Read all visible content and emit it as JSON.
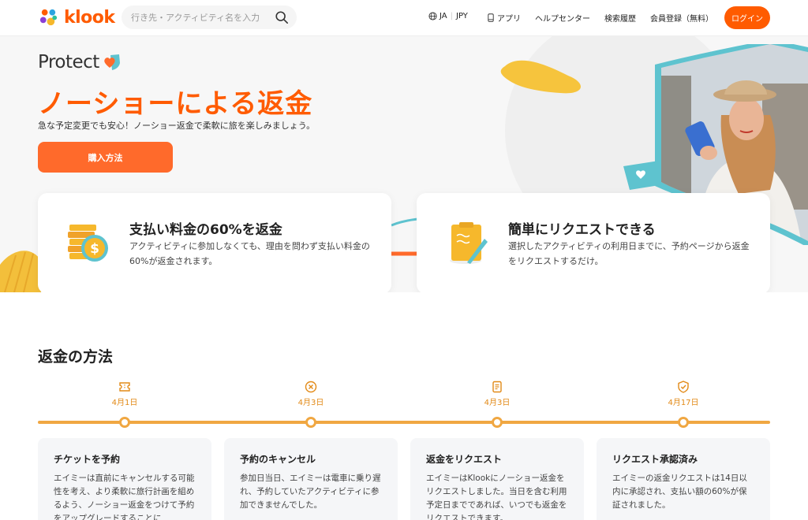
{
  "header": {
    "logo_text": "klook",
    "search_placeholder": "行き先・アクティビティ名を入力",
    "nav": {
      "lang": "JA",
      "currency": "JPY",
      "app": "アプリ",
      "help": "ヘルプセンター",
      "history": "検索履歴",
      "signup": "会員登録（無料）",
      "login": "ログイン"
    }
  },
  "hero": {
    "protect_label": "Protect",
    "title": "ノーショーによる返金",
    "subtitle": "急な予定変更でも安心！ノーショー返金で柔軟に旅を楽しみましょう。",
    "button": "購入方法"
  },
  "features": [
    {
      "title": "支払い料金の60%を返金",
      "desc": "アクティビティに参加しなくても、理由を問わず支払い料金の60%が返金されます。",
      "icon": "coins-icon"
    },
    {
      "title": "簡単にリクエストできる",
      "desc": "選択したアクティビティの利用日までに、予約ページから返金をリクエストするだけ。",
      "icon": "clipboard-icon"
    }
  ],
  "method": {
    "title": "返金の方法",
    "milestones": [
      {
        "date": "4月1日",
        "icon": "ticket-icon"
      },
      {
        "date": "4月3日",
        "icon": "cancel-icon"
      },
      {
        "date": "4月3日",
        "icon": "document-icon"
      },
      {
        "date": "4月17日",
        "icon": "shield-check-icon"
      }
    ],
    "steps": [
      {
        "title": "チケットを予約",
        "desc": "エイミーは直前にキャンセルする可能性を考え、より柔軟に旅行計画を組めるよう、ノーショー返金をつけて予約をアップグレードすることに"
      },
      {
        "title": "予約のキャンセル",
        "desc": "参加日当日、エイミーは電車に乗り遅れ、予約していたアクティビティに参加できませんでした。"
      },
      {
        "title": "返金をリクエスト",
        "desc": "エイミーはKlookにノーショー返金をリクエストしました。当日を含む利用予定日までであれば、いつでも返金をリクエストできます。"
      },
      {
        "title": "リクエスト承認済み",
        "desc": "エイミーの返金リクエストは14日以内に承認され、支払い額の60%が保証されました。"
      }
    ]
  },
  "colors": {
    "brand": "#ff5b00",
    "accent": "#f0a742",
    "teal": "#5ec3cf"
  }
}
